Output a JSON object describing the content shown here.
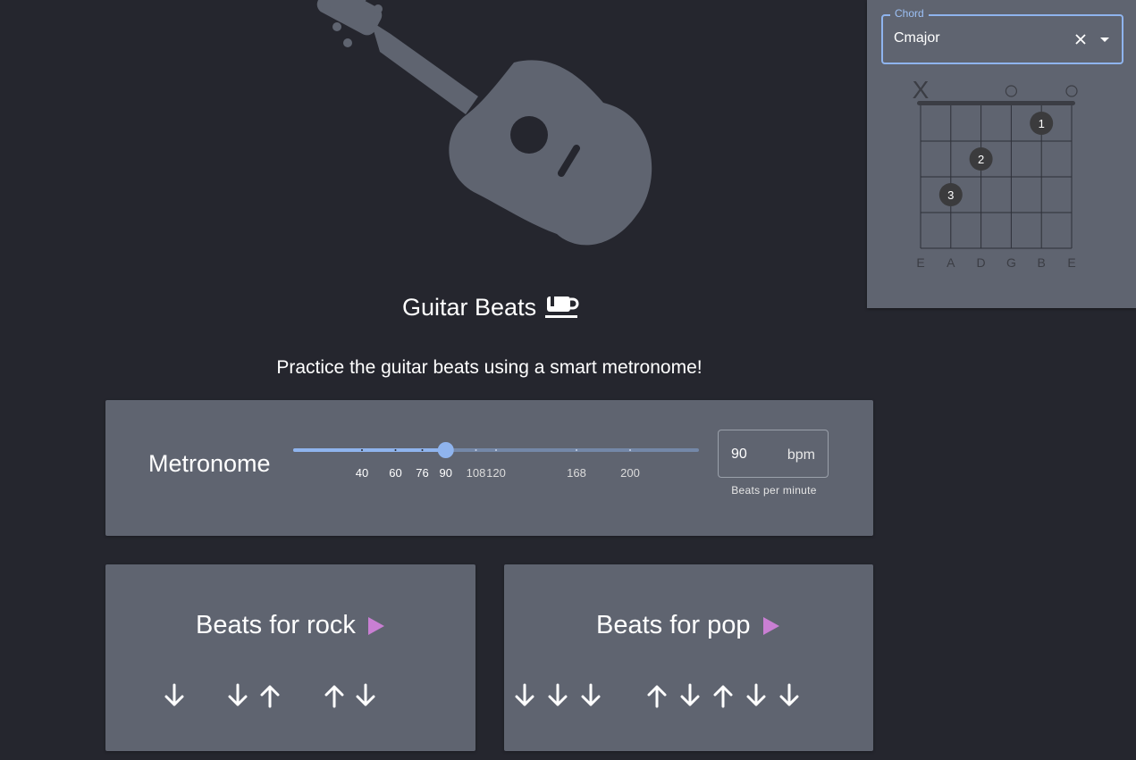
{
  "app": {
    "title": "Guitar Beats",
    "subtitle": "Practice the guitar beats using a smart metronome!"
  },
  "icons": {
    "logo": "guitar-icon",
    "title_icon": "coffee-cup-icon",
    "play": "play-icon",
    "down": "arrow-down-icon",
    "up": "arrow-up-icon",
    "clear": "close-icon",
    "dropdown": "caret-down-icon"
  },
  "colors": {
    "background": "#25262e",
    "card": "#5f6470",
    "accent": "#8fb4ee",
    "play": "#c97fd3",
    "guitar": "#5f6470"
  },
  "metronome": {
    "label": "Metronome",
    "value": 90,
    "min": 0,
    "max": 240,
    "ticks": [
      {
        "value": 40,
        "label": "40"
      },
      {
        "value": 60,
        "label": "60"
      },
      {
        "value": 76,
        "label": "76"
      },
      {
        "value": 90,
        "label": "90"
      },
      {
        "value": 108,
        "label": "108"
      },
      {
        "value": 120,
        "label": "120"
      },
      {
        "value": 168,
        "label": "168"
      },
      {
        "value": 200,
        "label": "200"
      }
    ],
    "bpm_value": "90",
    "bpm_unit": "bpm",
    "helper": "Beats per minute"
  },
  "rock": {
    "title": "Beats for rock",
    "strokes": [
      "down",
      "",
      "down",
      "up",
      "",
      "up",
      "down",
      ""
    ]
  },
  "pop": {
    "title": "Beats for pop",
    "strokes": [
      "down",
      "down",
      "down",
      "",
      "up",
      "down",
      "up",
      "down",
      "down"
    ]
  },
  "chord": {
    "legend": "Chord",
    "value": "Cmajor",
    "strings": [
      "E",
      "A",
      "D",
      "G",
      "B",
      "E"
    ],
    "markers": [
      "X",
      "",
      "",
      "O",
      "",
      "O"
    ],
    "fingers": [
      {
        "string": 5,
        "fret": 1,
        "label": "1"
      },
      {
        "string": 3,
        "fret": 2,
        "label": "2"
      },
      {
        "string": 2,
        "fret": 3,
        "label": "3"
      }
    ]
  }
}
